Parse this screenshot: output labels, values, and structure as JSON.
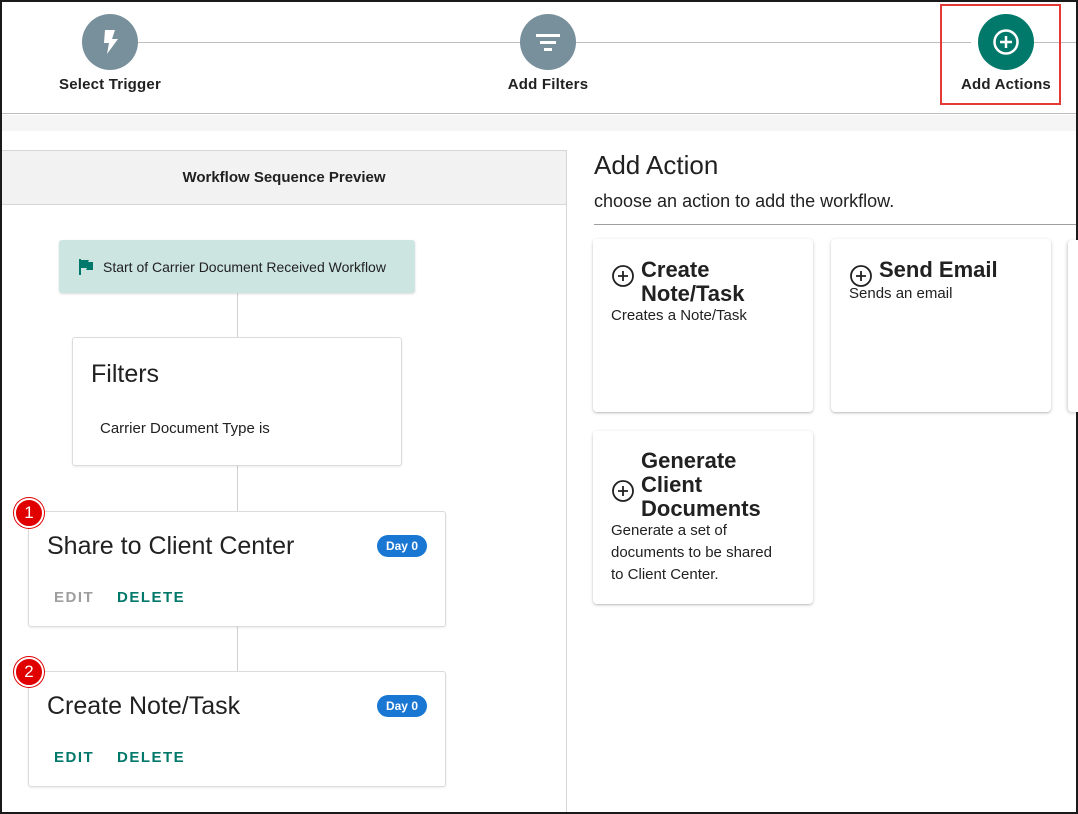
{
  "stepper": {
    "steps": [
      {
        "label": "Select Trigger",
        "icon": "lightning-icon",
        "state": "complete"
      },
      {
        "label": "Add Filters",
        "icon": "filter-icon",
        "state": "complete"
      },
      {
        "label": "Add Actions",
        "icon": "plus-circle-icon",
        "state": "active"
      }
    ]
  },
  "preview": {
    "header": "Workflow Sequence Preview",
    "start_label": "Start of Carrier Document Received Workflow",
    "filters": {
      "title": "Filters",
      "condition": "Carrier Document Type is"
    },
    "actions": [
      {
        "number": "1",
        "title": "Share to Client Center",
        "badge": "Day 0",
        "edit_label": "EDIT",
        "edit_enabled": false,
        "delete_label": "DELETE"
      },
      {
        "number": "2",
        "title": "Create Note/Task",
        "badge": "Day 0",
        "edit_label": "EDIT",
        "edit_enabled": true,
        "delete_label": "DELETE"
      }
    ]
  },
  "add_action": {
    "title": "Add Action",
    "subtitle": "choose an action to add the workflow.",
    "options": [
      {
        "title_lines": [
          "Create",
          "Note/Task"
        ],
        "description": "Creates a Note/Task"
      },
      {
        "title_lines": [
          "Send Email"
        ],
        "description": "Sends an email"
      },
      {
        "title_lines": [
          "Generate",
          "Client",
          "Documents"
        ],
        "description_lines": [
          "Generate a set of",
          "documents to be shared",
          "to Client Center."
        ]
      }
    ]
  },
  "colors": {
    "accent_green": "#00796b",
    "step_grey": "#78909c",
    "start_bg": "#cce5e0",
    "badge_blue": "#1976d2",
    "number_red": "#e00000",
    "highlight_red": "#e53935"
  }
}
